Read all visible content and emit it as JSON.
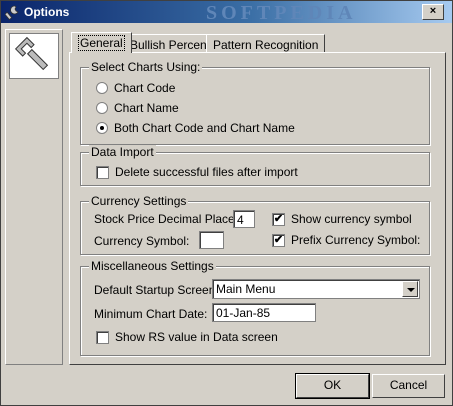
{
  "window": {
    "title": "Options",
    "watermark": "SOFTPEDIA",
    "close_label": "×"
  },
  "tabs": [
    {
      "label": "General",
      "active": true
    },
    {
      "label": "Bullish Percent",
      "active": false
    },
    {
      "label": "Pattern Recognition",
      "active": false
    }
  ],
  "select_charts": {
    "legend": "Select Charts Using:",
    "options": [
      {
        "label": "Chart Code",
        "selected": false
      },
      {
        "label": "Chart Name",
        "selected": false
      },
      {
        "label": "Both Chart Code and Chart Name",
        "selected": true
      }
    ]
  },
  "data_import": {
    "legend": "Data Import",
    "delete_label": "Delete successful files after import",
    "delete_checked": false
  },
  "currency": {
    "legend": "Currency Settings",
    "decimal_label": "Stock Price Decimal Places:",
    "decimal_value": "4",
    "symbol_label": "Currency Symbol:",
    "symbol_value": "",
    "show_symbol_label": "Show currency symbol",
    "show_symbol_checked": true,
    "prefix_label": "Prefix Currency Symbol:",
    "prefix_checked": true
  },
  "misc": {
    "legend": "Miscellaneous Settings",
    "startup_label": "Default Startup Screen:",
    "startup_value": "Main Menu",
    "min_date_label": "Minimum Chart Date:",
    "min_date_value": "01-Jan-85",
    "show_rs_label": "Show RS value in Data screen",
    "show_rs_checked": false
  },
  "buttons": {
    "ok": "OK",
    "cancel": "Cancel"
  },
  "check_mark": "✔"
}
